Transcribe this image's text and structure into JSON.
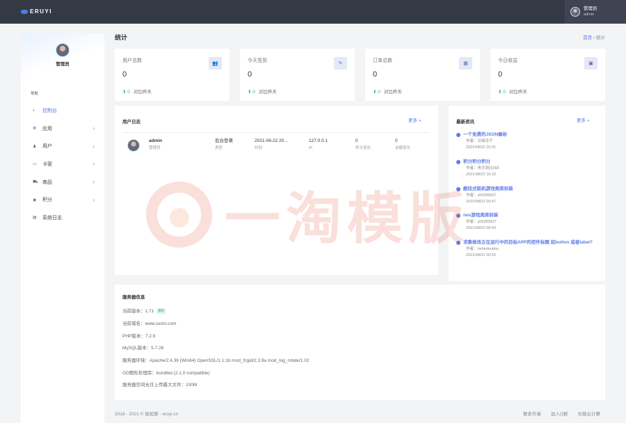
{
  "brand": {
    "name": "ERUYI"
  },
  "header": {
    "user_name": "管理员",
    "user_role": "admin"
  },
  "sidebar": {
    "user_name": "管理员",
    "nav_title": "导航",
    "items": [
      {
        "label": "控制台",
        "icon": "dashboard-icon",
        "arrow": false
      },
      {
        "label": "应用",
        "icon": "app-icon",
        "arrow": true
      },
      {
        "label": "用户",
        "icon": "user-icon",
        "arrow": true
      },
      {
        "label": "卡密",
        "icon": "card-icon",
        "arrow": true
      },
      {
        "label": "商品",
        "icon": "cart-icon",
        "arrow": true
      },
      {
        "label": "积分",
        "icon": "points-icon",
        "arrow": true
      },
      {
        "label": "系统日志",
        "icon": "log-icon",
        "arrow": false
      }
    ]
  },
  "page": {
    "title": "统计",
    "breadcrumb_home": "首页",
    "breadcrumb_current": "统计"
  },
  "stats": [
    {
      "title": "用户总数",
      "value": "0",
      "delta": "0",
      "compare": "对比昨天",
      "icon": "users-icon"
    },
    {
      "title": "今天签到",
      "value": "0",
      "delta": "0",
      "compare": "对比昨天",
      "icon": "checkin-icon"
    },
    {
      "title": "订单总数",
      "value": "0",
      "delta": "0",
      "compare": "对比昨天",
      "icon": "calendar-icon"
    },
    {
      "title": "今日收益",
      "value": "0",
      "delta": "0",
      "compare": "对比昨天",
      "icon": "money-icon"
    }
  ],
  "user_log": {
    "title": "用户日志",
    "more": "更多",
    "row": {
      "name": "admin",
      "role": "管理员",
      "action": "后台登录",
      "action_label": "类型",
      "time": "2021-08-22 20...",
      "time_label": "时间",
      "ip": "127.0.0.1",
      "ip_label": "IP",
      "points": "0",
      "points_label": "积分变化",
      "balance": "0",
      "balance_label": "余额变化"
    }
  },
  "news": {
    "title": "最新资讯",
    "more": "更多",
    "items": [
      {
        "title": "一个免费的JSON解析",
        "author": "作者：访缘凉子",
        "date": "2021/08/22 20:31"
      },
      {
        "title": "积分积分积分",
        "author": "作者：青尤阔比666",
        "date": "2021/08/22 16:10"
      },
      {
        "title": "酷炫式街机游戏类库封装",
        "author": "作者：yh5285627",
        "date": "2021/08/22 09:47"
      },
      {
        "title": "nes游戏类库封装",
        "author": "作者：yh5285627",
        "date": "2021/08/22 09:43"
      },
      {
        "title": "求教修改正在运行中的目标APP的控件标题 如button 或者label?",
        "author": "作者：hehedoudou",
        "date": "2021/08/22 00:53"
      }
    ]
  },
  "server": {
    "title": "服务器信息",
    "lines": [
      {
        "label": "当前版本：",
        "value": "1.71",
        "badge": "最新"
      },
      {
        "label": "当前域名：",
        "value": "www.ceshi.com"
      },
      {
        "label": "PHP版本：",
        "value": "7.2.9"
      },
      {
        "label": "MySQL版本：",
        "value": "5.7.26"
      },
      {
        "label": "服务器环境：",
        "value": "Apache/2.4.39 (Win64) OpenSSL/1.1.1b mod_fcgid/2.3.9a mod_log_rotate/1.02"
      },
      {
        "label": "GD图形处理库：",
        "value": "bundled (2.1.0 compatible)"
      },
      {
        "label": "服务器空间允许上传最大文件：",
        "value": "100M"
      }
    ]
  },
  "footer": {
    "copyright": "2018 - 2021 © 易如意 - eruyi.cn",
    "links": [
      "联系作者",
      "加入Q群",
      "光棱云计算"
    ]
  },
  "watermark": {
    "text": "一淘模版"
  },
  "colors": {
    "topbar": "#343946",
    "accent": "#5b7be5",
    "up": "#2bb673"
  }
}
